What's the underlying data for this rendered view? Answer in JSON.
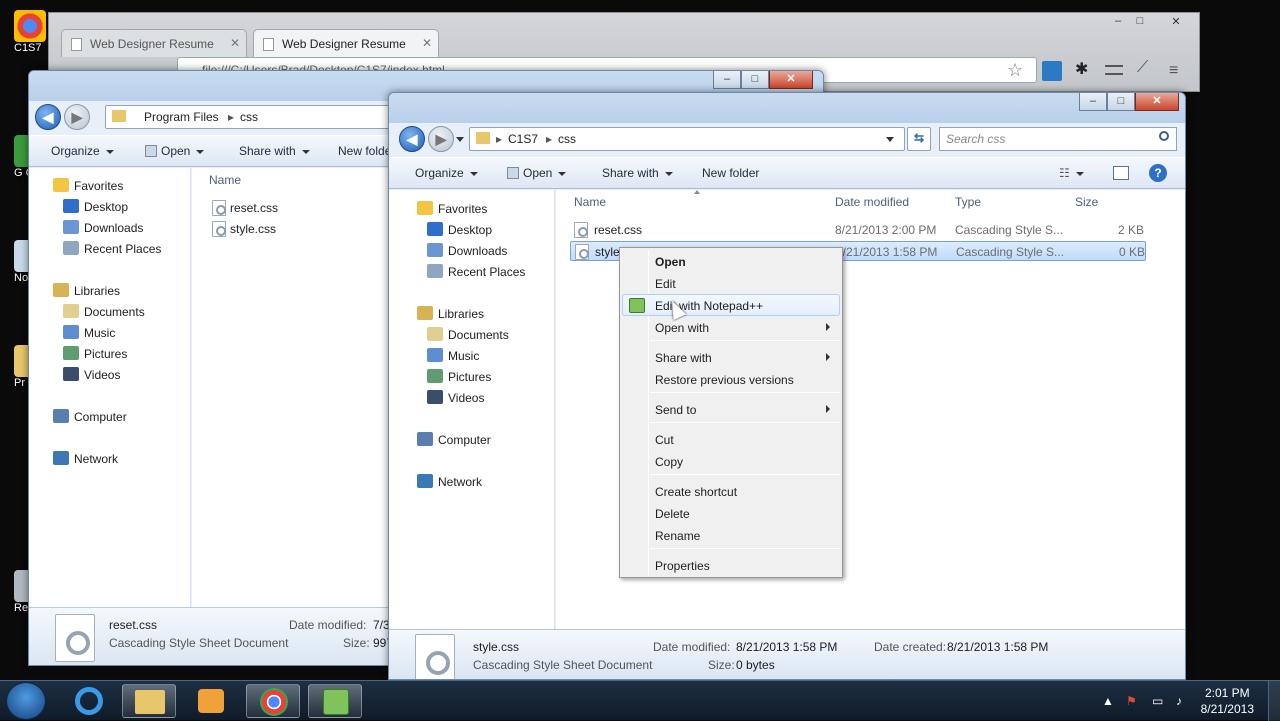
{
  "desktop": {
    "icons": [
      {
        "label": "C1S7"
      },
      {
        "label": "G\nC"
      },
      {
        "label": "Not"
      },
      {
        "label": "Pr"
      },
      {
        "label": "Rec"
      }
    ]
  },
  "chrome": {
    "tabs": [
      {
        "label": "Web Designer Resume"
      },
      {
        "label": "Web Designer Resume"
      }
    ],
    "omnibox": "file:///C:/Users/Brad/Desktop/C1S7/index.html",
    "controls": {
      "minimize": "–",
      "maximize": "□",
      "close": "✕"
    }
  },
  "back_window": {
    "breadcrumb": [
      "Program Files",
      "css"
    ],
    "commands": [
      "Organize",
      "Open",
      "Share with",
      "New folder"
    ],
    "nav": {
      "favorites": "Favorites",
      "favorites_items": [
        "Desktop",
        "Downloads",
        "Recent Places"
      ],
      "libraries": "Libraries",
      "libraries_items": [
        "Documents",
        "Music",
        "Pictures",
        "Videos"
      ],
      "computer": "Computer",
      "network": "Network"
    },
    "column_name": "Name",
    "files": [
      "reset.css",
      "style.css"
    ],
    "details": {
      "filename": "reset.css",
      "type": "Cascading Style Sheet Document",
      "date_label": "Date modified:",
      "date_value": "7/3",
      "size_label": "Size:",
      "size_value": "997"
    }
  },
  "front_window": {
    "breadcrumb": [
      "C1S7",
      "css"
    ],
    "search_placeholder": "Search css",
    "commands": [
      "Organize",
      "Open",
      "Share with",
      "New folder"
    ],
    "nav": {
      "favorites": "Favorites",
      "favorites_items": [
        "Desktop",
        "Downloads",
        "Recent Places"
      ],
      "libraries": "Libraries",
      "libraries_items": [
        "Documents",
        "Music",
        "Pictures",
        "Videos"
      ],
      "computer": "Computer",
      "network": "Network"
    },
    "columns": [
      "Name",
      "Date modified",
      "Type",
      "Size"
    ],
    "files": [
      {
        "name": "reset.css",
        "date": "8/21/2013 2:00 PM",
        "type": "Cascading Style S...",
        "size": "2 KB"
      },
      {
        "name": "style",
        "date": "8/21/2013 1:58 PM",
        "type": "Cascading Style S...",
        "size": "0 KB"
      }
    ],
    "details": {
      "filename": "style.css",
      "type": "Cascading Style Sheet Document",
      "date_modified_label": "Date modified:",
      "date_modified_value": "8/21/2013 1:58 PM",
      "size_label": "Size:",
      "size_value": "0 bytes",
      "date_created_label": "Date created:",
      "date_created_value": "8/21/2013 1:58 PM"
    }
  },
  "context_menu": {
    "items": [
      {
        "label": "Open",
        "bold": true
      },
      {
        "label": "Edit"
      },
      {
        "label": "Edit with Notepad++",
        "icon": "notepad-plus-plus-icon",
        "highlighted": true
      },
      {
        "label": "Open with",
        "submenu": true
      },
      {
        "label": "Share with",
        "submenu": true
      },
      {
        "label": "Restore previous versions"
      },
      {
        "label": "Send to",
        "submenu": true
      },
      {
        "label": "Cut"
      },
      {
        "label": "Copy"
      },
      {
        "label": "Create shortcut"
      },
      {
        "label": "Delete"
      },
      {
        "label": "Rename"
      },
      {
        "label": "Properties"
      }
    ]
  },
  "taskbar": {
    "time": "2:01 PM",
    "date": "8/21/2013",
    "pinned": [
      "internet-explorer-icon",
      "windows-explorer-icon",
      "media-player-icon",
      "chrome-icon",
      "notepad-plus-plus-icon"
    ]
  },
  "colors": {
    "accent_blue": "#1c5fb8",
    "selection": "#c1dcfb",
    "taskbar": "#1d2f43"
  }
}
